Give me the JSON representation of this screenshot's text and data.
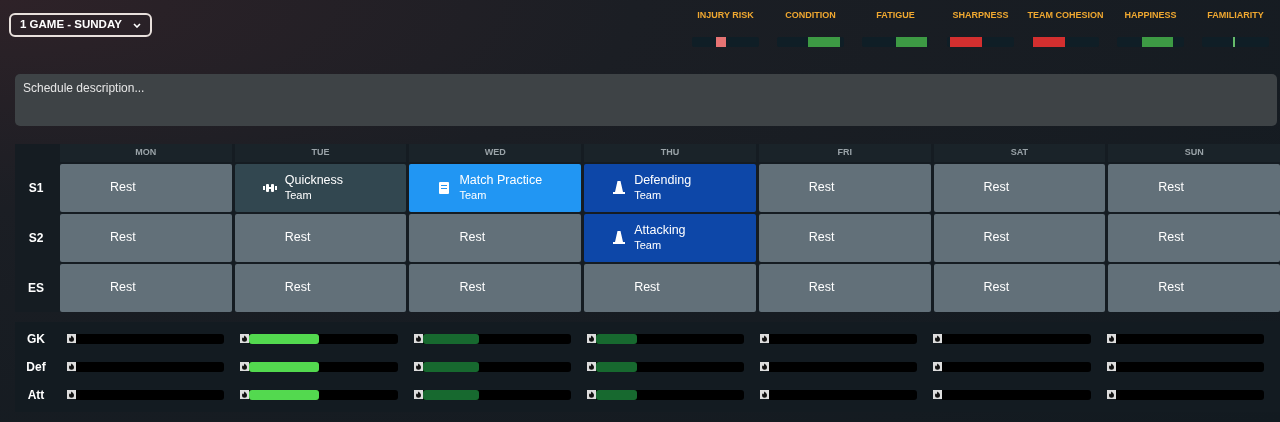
{
  "schedule_dropdown": {
    "label": "1 GAME - SUNDAY"
  },
  "indicators": [
    {
      "label": "INJURY RISK",
      "kind": "block",
      "color": "#e57373"
    },
    {
      "label": "CONDITION",
      "kind": "range",
      "color": "#3d9a44"
    },
    {
      "label": "FATIGUE",
      "kind": "range",
      "color": "#3d9a44"
    },
    {
      "label": "SHARPNESS",
      "kind": "range",
      "color": "#d32f2f"
    },
    {
      "label": "TEAM COHESION",
      "kind": "range",
      "color": "#d32f2f"
    },
    {
      "label": "HAPPINESS",
      "kind": "range",
      "color": "#3d9a44"
    },
    {
      "label": "FAMILIARITY",
      "kind": "tick",
      "color": "#66bb6a"
    }
  ],
  "description": {
    "placeholder": "Schedule description..."
  },
  "days": [
    "MON",
    "TUE",
    "WED",
    "THU",
    "FRI",
    "SAT",
    "SUN"
  ],
  "sessions": [
    {
      "label": "S1",
      "cells": [
        {
          "kind": "rest",
          "title": "Rest"
        },
        {
          "kind": "general",
          "title": "Quickness",
          "subtitle": "Team"
        },
        {
          "kind": "match",
          "title": "Match Practice",
          "subtitle": "Team"
        },
        {
          "kind": "tactical",
          "title": "Defending",
          "subtitle": "Team"
        },
        {
          "kind": "rest",
          "title": "Rest"
        },
        {
          "kind": "rest",
          "title": "Rest"
        },
        {
          "kind": "rest",
          "title": "Rest"
        }
      ]
    },
    {
      "label": "S2",
      "cells": [
        {
          "kind": "rest",
          "title": "Rest"
        },
        {
          "kind": "rest",
          "title": "Rest"
        },
        {
          "kind": "rest",
          "title": "Rest"
        },
        {
          "kind": "tactical",
          "title": "Attacking",
          "subtitle": "Team"
        },
        {
          "kind": "rest",
          "title": "Rest"
        },
        {
          "kind": "rest",
          "title": "Rest"
        },
        {
          "kind": "rest",
          "title": "Rest"
        }
      ]
    },
    {
      "label": "ES",
      "cells": [
        {
          "kind": "rest",
          "title": "Rest"
        },
        {
          "kind": "rest",
          "title": "Rest"
        },
        {
          "kind": "rest",
          "title": "Rest"
        },
        {
          "kind": "rest",
          "title": "Rest"
        },
        {
          "kind": "rest",
          "title": "Rest"
        },
        {
          "kind": "rest",
          "title": "Rest"
        },
        {
          "kind": "rest",
          "title": "Rest"
        }
      ]
    }
  ],
  "workload": [
    {
      "label": "GK",
      "bars": [
        {
          "kind": "empty"
        },
        {
          "kind": "filled",
          "level": 0.47,
          "color": "#53d94f"
        },
        {
          "kind": "filled",
          "level": 0.38,
          "color": "#17692f"
        },
        {
          "kind": "filled",
          "level": 0.28,
          "color": "#17692f"
        },
        {
          "kind": "empty"
        },
        {
          "kind": "empty"
        },
        {
          "kind": "empty"
        }
      ]
    },
    {
      "label": "Def",
      "bars": [
        {
          "kind": "empty"
        },
        {
          "kind": "filled",
          "level": 0.47,
          "color": "#53d94f"
        },
        {
          "kind": "filled",
          "level": 0.38,
          "color": "#17692f"
        },
        {
          "kind": "filled",
          "level": 0.28,
          "color": "#17692f"
        },
        {
          "kind": "empty"
        },
        {
          "kind": "empty"
        },
        {
          "kind": "empty"
        }
      ]
    },
    {
      "label": "Att",
      "bars": [
        {
          "kind": "empty"
        },
        {
          "kind": "filled",
          "level": 0.47,
          "color": "#53d94f"
        },
        {
          "kind": "filled",
          "level": 0.38,
          "color": "#17692f"
        },
        {
          "kind": "filled",
          "level": 0.28,
          "color": "#17692f"
        },
        {
          "kind": "empty"
        },
        {
          "kind": "empty"
        },
        {
          "kind": "empty"
        }
      ]
    }
  ]
}
